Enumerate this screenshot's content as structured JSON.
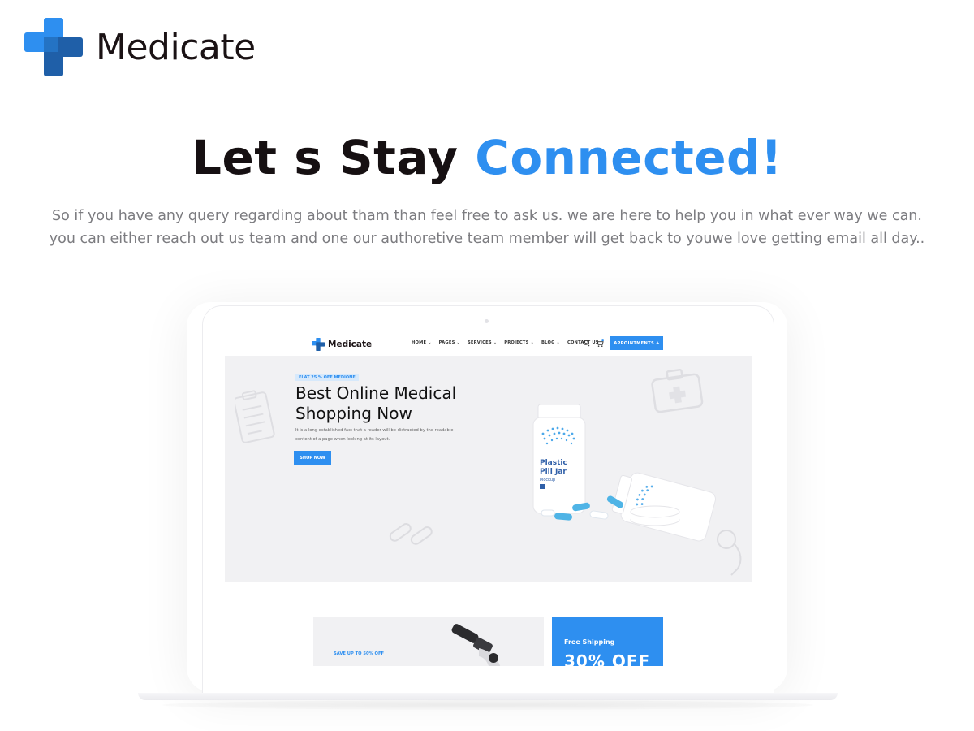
{
  "brand": {
    "name": "Medicate",
    "logo_icon": "medical-cross-icon"
  },
  "hero": {
    "title_main": "Let s Stay ",
    "title_accent": "Connected!",
    "description": "So if you have any query regarding about tham than feel free to ask us. we are here to help you in what ever way we can. you can either reach out us team and one our authoretive team member will get back to youwe love getting email all day.."
  },
  "colors": {
    "accent": "#2e8ff0",
    "brand_dark": "#1f5fa8",
    "text_dark": "#161012",
    "text_muted": "#7c7c80"
  },
  "mockup": {
    "logo_text": "Medicate",
    "nav": {
      "items": [
        {
          "label": "HOME",
          "chevron": "⌄"
        },
        {
          "label": "PAGES",
          "chevron": "⌄"
        },
        {
          "label": "SERVICES",
          "chevron": "⌄"
        },
        {
          "label": "PROJECTS",
          "chevron": "⌄"
        },
        {
          "label": "BLOG",
          "chevron": "⌄"
        },
        {
          "label": "CONTACT US",
          "chevron": ""
        }
      ],
      "search_icon": "search-icon",
      "cart_icon": "cart-icon",
      "appointments_label": "APPOINTMENTS +"
    },
    "hero": {
      "badge": "FLAT 25 % OFF MEDIONE",
      "headline_line1": "Best Online Medical",
      "headline_line2": "Shopping Now",
      "subtext": "It is a long established fact that a reader will be distracted by the readable content of a page when looking at its layout.",
      "button": "SHOP NOW",
      "product_label_line1": "Plastic",
      "product_label_line2": "Pill Jar",
      "product_label_line3": "Mockup"
    },
    "promo_left": {
      "text": "SAVE UP TO 50% OFF"
    },
    "promo_right": {
      "title": "Free Shipping",
      "big": "30% OFF"
    }
  }
}
